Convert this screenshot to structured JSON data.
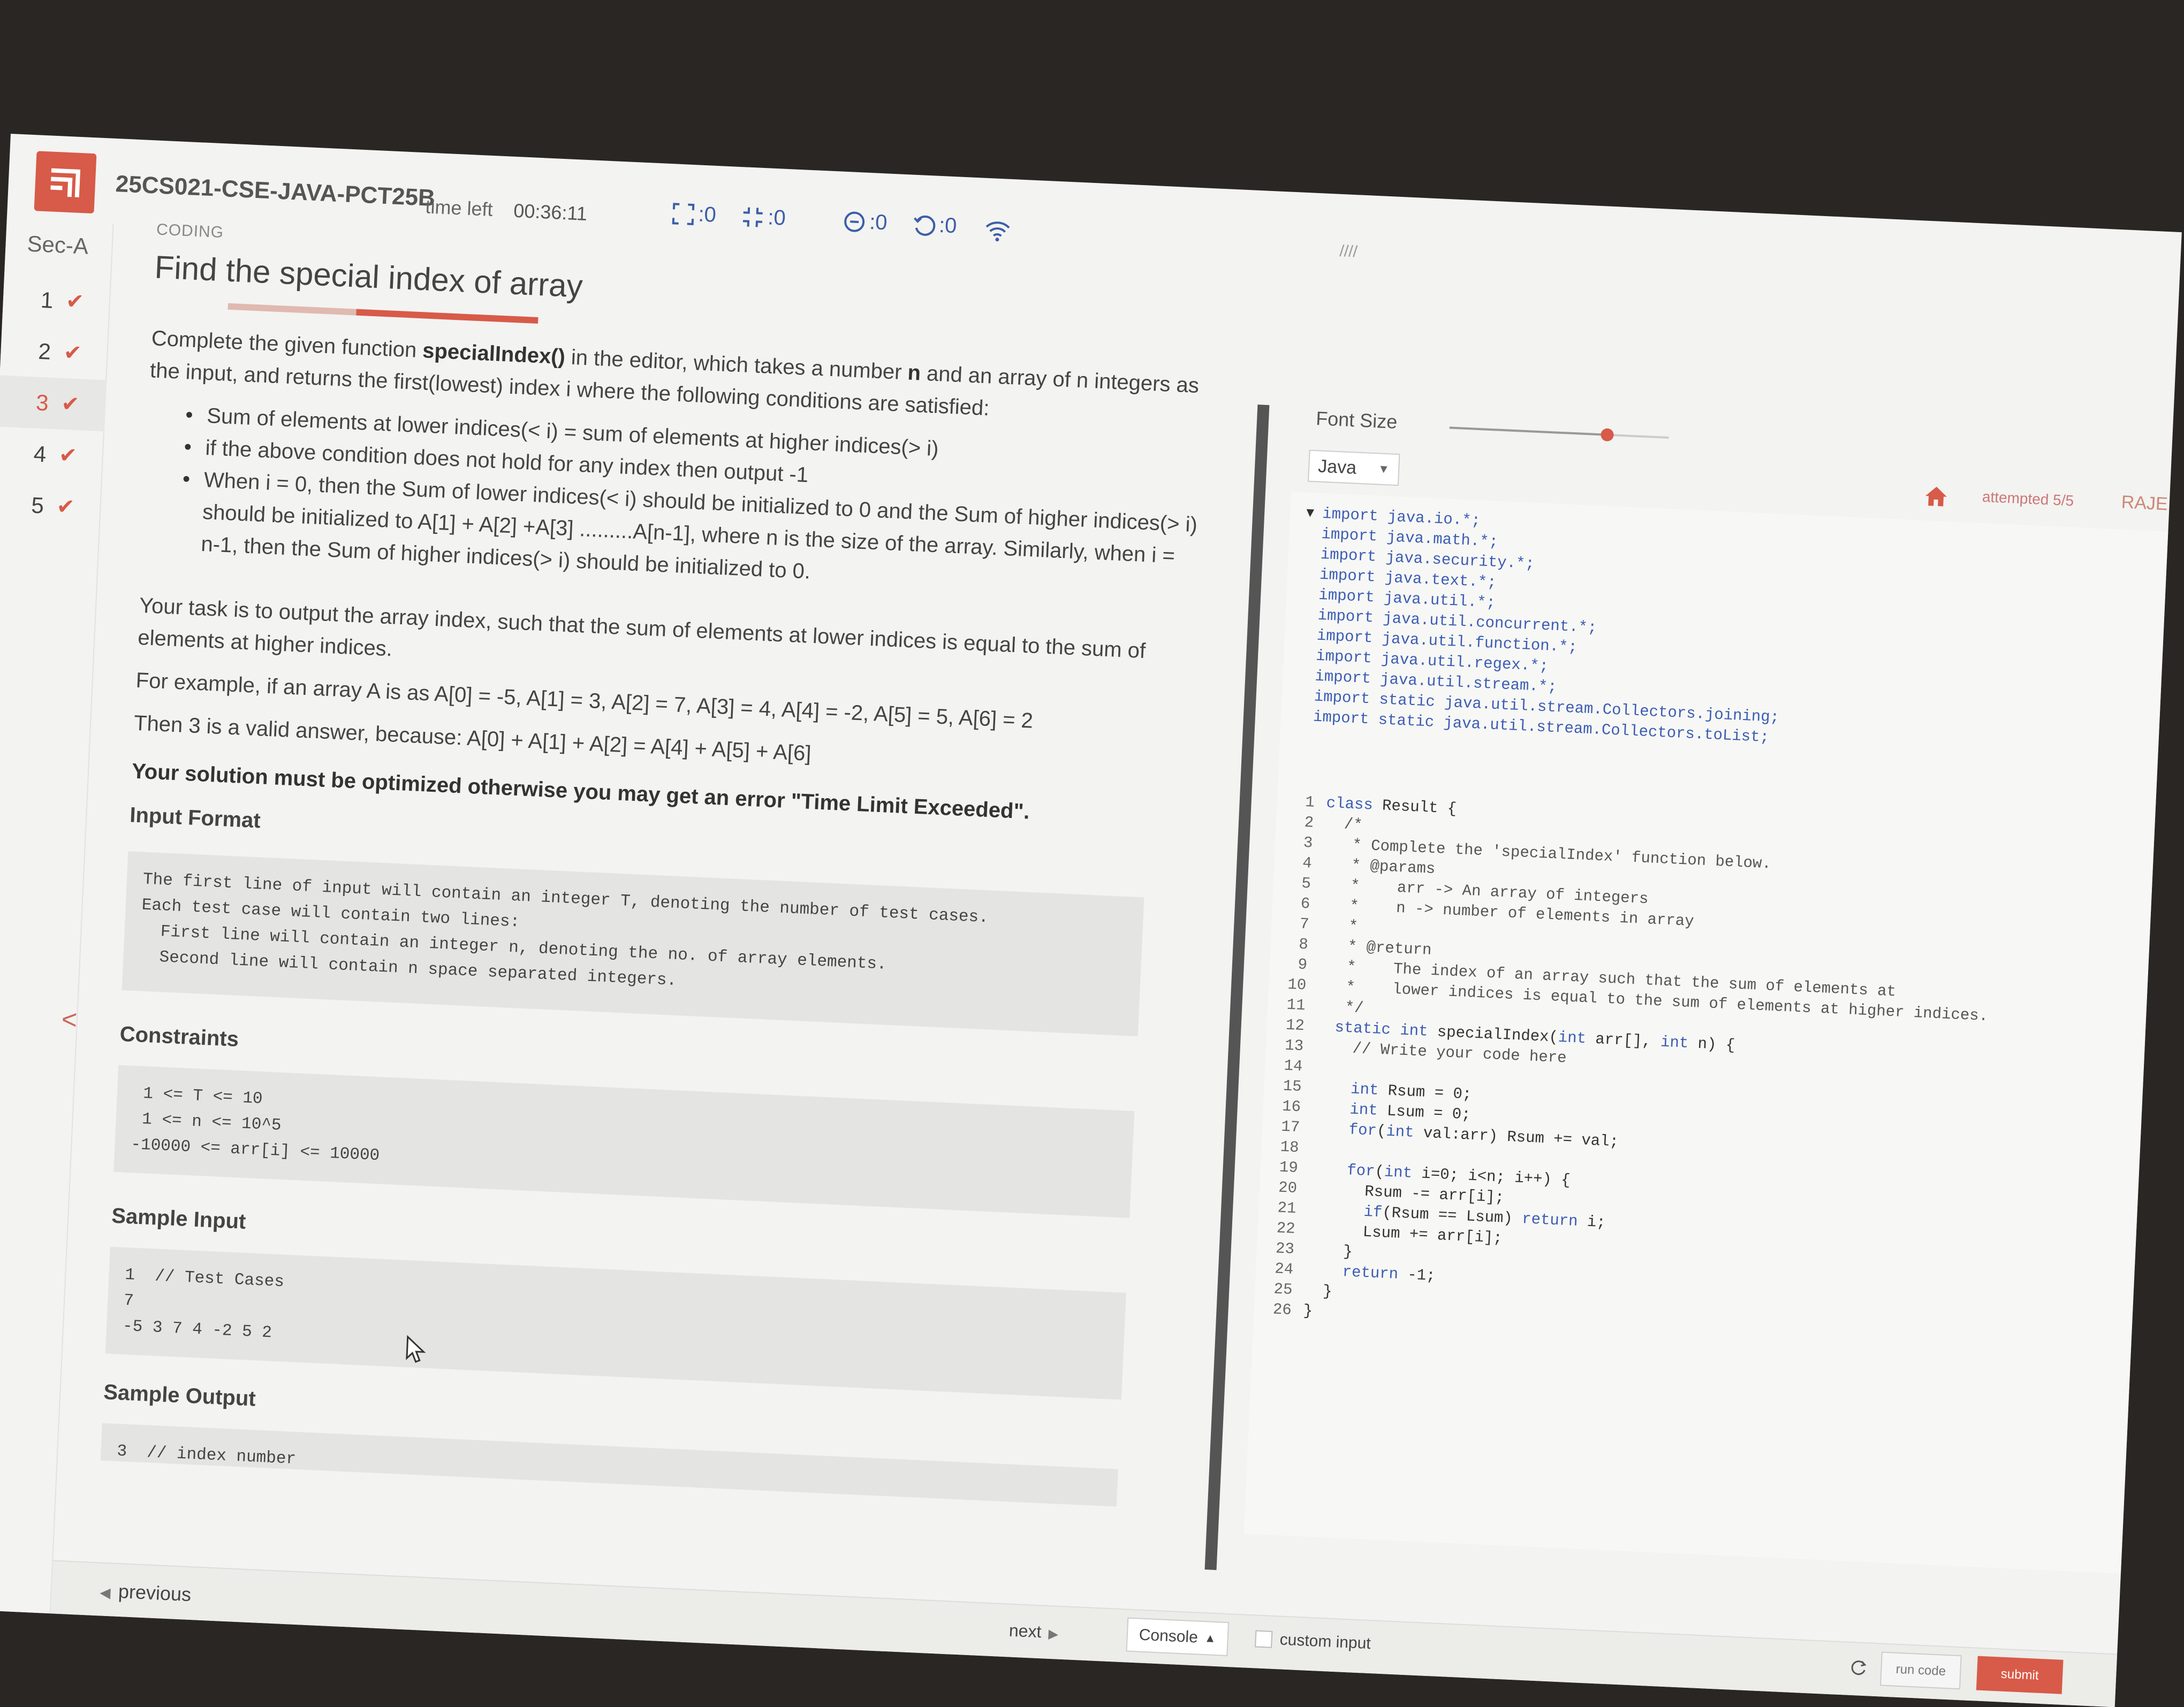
{
  "header": {
    "course": "25CS021-CSE-JAVA-PCT25B",
    "time_label": "time left",
    "time_value": "00:36:11",
    "stats": [
      ":0",
      ":0",
      ":0",
      ":0"
    ]
  },
  "sidebar": {
    "section": "Sec-A",
    "items": [
      {
        "label": "1",
        "done": true
      },
      {
        "label": "2",
        "done": true
      },
      {
        "label": "3",
        "done": true
      },
      {
        "label": "4",
        "done": true
      },
      {
        "label": "5",
        "done": true
      }
    ],
    "check_glyph": "✔",
    "collapse_glyph": "<"
  },
  "problem": {
    "category": "CODING",
    "title": "Find the special index of array",
    "intro_1": "Complete the given function ",
    "intro_fn": "specialIndex()",
    "intro_2": " in the editor, which takes a number ",
    "intro_n": "n",
    "intro_3": " and an array of n integers as the input, and returns the first(lowest) index i where the following conditions are satisfied:",
    "bullets": [
      "Sum of elements at lower indices(< i) = sum of elements at higher indices(> i)",
      "if the above condition does not hold for any index then output -1",
      "When i = 0, then the Sum of lower indices(< i) should be initialized to 0 and the Sum of higher indices(> i) should be initialized to A[1] + A[2] +A[3] .........A[n-1], where n is the size of the array. Similarly, when i = n-1, then the Sum of higher indices(> i) should be initialized to 0."
    ],
    "task": "Your task is to output the array index, such that the sum of elements at lower indices is equal to the sum of elements at higher indices.",
    "example": "For example, if an array A is as A[0] = -5, A[1] = 3, A[2] = 7, A[3] = 4, A[4] = -2, A[5] = 5, A[6] = 2",
    "example_2": "Then 3 is a valid answer, because: A[0] + A[1] + A[2] = A[4] + A[5] + A[6]",
    "warning": "Your solution must be optimized otherwise you may get an error \"Time Limit Exceeded\".",
    "input_format_heading": "Input Format",
    "input_format": "The first line of input will contain an integer T, denoting the number of test cases.\nEach test case will contain two lines:\n  First line will contain an integer n, denoting the no. of array elements.\n  Second line will contain n space separated integers.",
    "constraints_heading": "Constraints",
    "constraints": " 1 <= T <= 10\n 1 <= n <= 10^5\n-10000 <= arr[i] <= 10000",
    "sample_input_heading": "Sample Input",
    "sample_input": "1  // Test Cases\n7\n-5 3 7 4 -2 5 2",
    "sample_output_heading": "Sample Output",
    "sample_output": "3  // index number"
  },
  "editor": {
    "font_size_label": "Font Size",
    "font_size_level": 0.72,
    "language": "Java",
    "attempted": "attempted 5/5",
    "user": "RAJE",
    "imports": [
      "import java.io.*;",
      "import java.math.*;",
      "import java.security.*;",
      "import java.text.*;",
      "import java.util.*;",
      "import java.util.concurrent.*;",
      "import java.util.function.*;",
      "import java.util.regex.*;",
      "import java.util.stream.*;",
      "import static java.util.stream.Collectors.joining;",
      "import static java.util.stream.Collectors.toList;"
    ],
    "code": [
      {
        "n": "1",
        "t": "class Result {"
      },
      {
        "n": "2",
        "t": "  /*"
      },
      {
        "n": "3",
        "t": "   * Complete the 'specialIndex' function below."
      },
      {
        "n": "4",
        "t": "   * @params"
      },
      {
        "n": "5",
        "t": "   *    arr -> An array of integers"
      },
      {
        "n": "6",
        "t": "   *    n -> number of elements in array"
      },
      {
        "n": "7",
        "t": "   *"
      },
      {
        "n": "8",
        "t": "   * @return"
      },
      {
        "n": "9",
        "t": "   *    The index of an array such that the sum of elements at"
      },
      {
        "n": "10",
        "t": "   *    lower indices is equal to the sum of elements at higher indices."
      },
      {
        "n": "11",
        "t": "   */"
      },
      {
        "n": "12",
        "t": "  static int specialIndex(int arr[], int n) {"
      },
      {
        "n": "13",
        "t": "    // Write your code here"
      },
      {
        "n": "14",
        "t": ""
      },
      {
        "n": "15",
        "t": "    int Rsum = 0;"
      },
      {
        "n": "16",
        "t": "    int Lsum = 0;"
      },
      {
        "n": "17",
        "t": "    for(int val:arr) Rsum += val;"
      },
      {
        "n": "18",
        "t": ""
      },
      {
        "n": "19",
        "t": "    for(int i=0; i<n; i++) {"
      },
      {
        "n": "20",
        "t": "      Rsum -= arr[i];"
      },
      {
        "n": "21",
        "t": "      if(Rsum == Lsum) return i;"
      },
      {
        "n": "22",
        "t": "      Lsum += arr[i];"
      },
      {
        "n": "23",
        "t": "    }"
      },
      {
        "n": "24",
        "t": "    return -1;"
      },
      {
        "n": "25",
        "t": "  }"
      },
      {
        "n": "26",
        "t": "}"
      }
    ]
  },
  "footer": {
    "previous": "previous",
    "next": "next",
    "console": "Console",
    "custom_input": "custom input",
    "run": "run code",
    "submit": "submit"
  },
  "colors": {
    "accent": "#d85a48",
    "stat_blue": "#3b5ea8",
    "keyword": "#3c5db3"
  }
}
